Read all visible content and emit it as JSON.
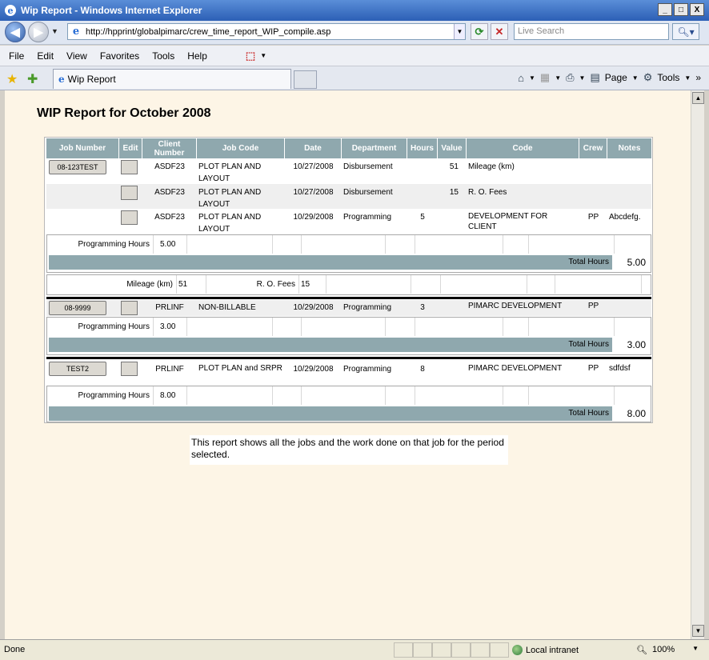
{
  "window": {
    "title": "Wip Report - Windows Internet Explorer",
    "min": "_",
    "max": "□",
    "close": "X"
  },
  "address": {
    "url": "http://hpprint/globalpimarc/crew_time_report_WIP_compile.asp",
    "search_placeholder": "Live Search"
  },
  "menu": {
    "file": "File",
    "edit": "Edit",
    "view": "View",
    "favorites": "Favorites",
    "tools": "Tools",
    "help": "Help"
  },
  "tab": {
    "label": "Wip Report"
  },
  "commandbar": {
    "page": "Page",
    "tools": "Tools",
    "more": "»"
  },
  "report": {
    "title": "WIP Report for October 2008",
    "headers": [
      "Job Number",
      "Edit",
      "Client Number",
      "Job Code",
      "Date",
      "Department",
      "Hours",
      "Value",
      "Code",
      "Crew",
      "Notes"
    ],
    "jobs": [
      {
        "job_number": "08-123TEST",
        "rows": [
          {
            "client": "ASDF23",
            "job_code": "PLOT PLAN AND LAYOUT",
            "date": "10/27/2008",
            "department": "Disbursement",
            "hours": "",
            "value": "51",
            "code": "Mileage (km)",
            "crew": "",
            "notes": ""
          },
          {
            "client": "ASDF23",
            "job_code": "PLOT PLAN AND LAYOUT",
            "date": "10/27/2008",
            "department": "Disbursement",
            "hours": "",
            "value": "15",
            "code": "R. O. Fees",
            "crew": "",
            "notes": ""
          },
          {
            "client": "ASDF23",
            "job_code": "PLOT PLAN AND LAYOUT",
            "date": "10/29/2008",
            "department": "Programming",
            "hours": "5",
            "value": "",
            "code": "DEVELOPMENT FOR CLIENT",
            "crew": "PP",
            "notes": "Abcdefg."
          }
        ],
        "summary_label": "Programming Hours",
        "summary_value": "5.00",
        "total_label": "Total Hours",
        "total_value": "5.00",
        "disb_1_label": "Mileage (km)",
        "disb_1_value": "51",
        "disb_2_label": "R. O. Fees",
        "disb_2_value": "15"
      },
      {
        "job_number": "08-9999",
        "rows": [
          {
            "client": "PRLINF",
            "job_code": "NON-BILLABLE",
            "date": "10/29/2008",
            "department": "Programming",
            "hours": "3",
            "value": "",
            "code": "PIMARC DEVELOPMENT",
            "crew": "PP",
            "notes": ""
          }
        ],
        "summary_label": "Programming Hours",
        "summary_value": "3.00",
        "total_label": "Total Hours",
        "total_value": "3.00"
      },
      {
        "job_number": "TEST2",
        "rows": [
          {
            "client": "PRLINF",
            "job_code": "PLOT PLAN and SRPR",
            "date": "10/29/2008",
            "department": "Programming",
            "hours": "8",
            "value": "",
            "code": "PIMARC DEVELOPMENT",
            "crew": "PP",
            "notes": "sdfdsf"
          }
        ],
        "summary_label": "Programming Hours",
        "summary_value": "8.00",
        "total_label": "Total Hours",
        "total_value": "8.00"
      }
    ],
    "footnote": "This report shows all the jobs and the work done on that job for the period selected."
  },
  "status": {
    "text": "Done",
    "zone": "Local intranet",
    "zoom": "100%"
  },
  "colors": {
    "header_bg": "#8fa8ae",
    "page_bg": "#fdf5e6"
  }
}
